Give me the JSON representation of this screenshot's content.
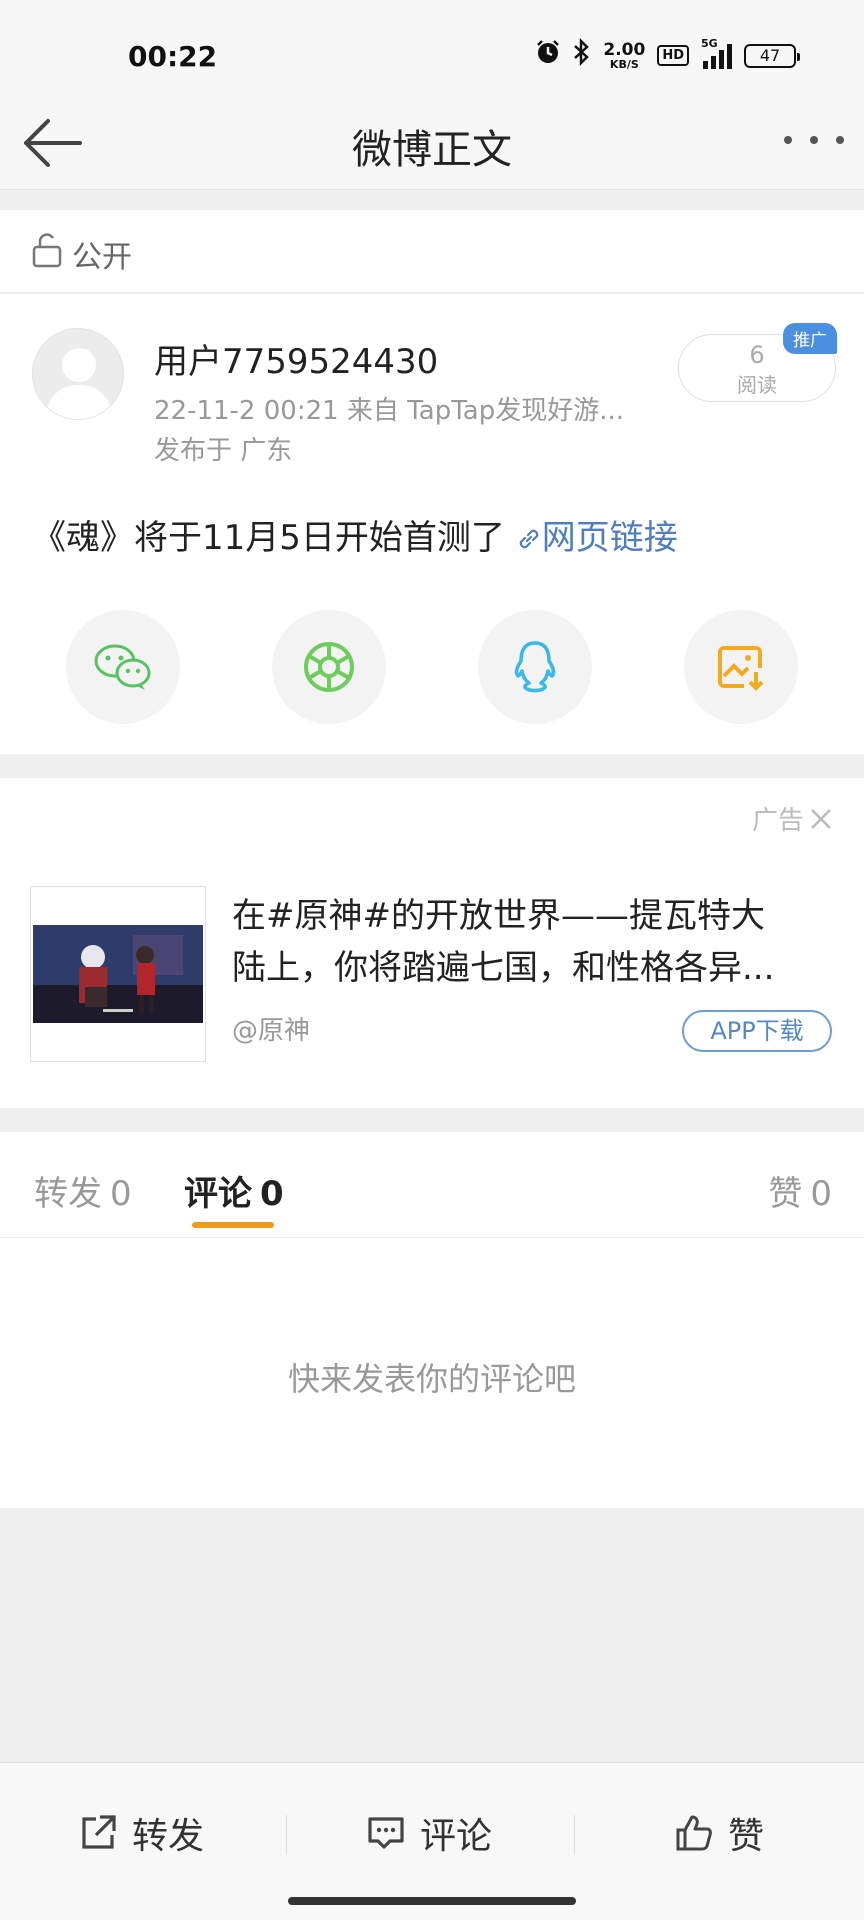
{
  "status_bar": {
    "time": "00:22",
    "net_speed": "2.00",
    "net_unit": "KB/S",
    "hd": "HD",
    "signal_label": "5G",
    "battery": "47"
  },
  "nav": {
    "title": "微博正文"
  },
  "visibility": {
    "label": "公开"
  },
  "post": {
    "username": "用户7759524430",
    "meta": "22-11-2 00:21   来自 TapTap发现好游...",
    "location": "发布于 广东",
    "read_count": "6",
    "read_label": "阅读",
    "promo_badge": "推广",
    "text": "《魂》将于11月5日开始首测了",
    "link_text": "网页链接",
    "share_buttons": [
      {
        "icon": "wechat-icon",
        "color": "#5ac264"
      },
      {
        "icon": "moments-icon",
        "color": "#6dcc5c"
      },
      {
        "icon": "qq-icon",
        "color": "#3cb8e6"
      },
      {
        "icon": "save-image-icon",
        "color": "#f4a91f"
      }
    ]
  },
  "ad": {
    "tag": "广告",
    "text_line1": "在#原神#的开放世界——提瓦特大",
    "text_line2": "陆上，你将踏遍七国，和性格各异...",
    "source": "@原神",
    "button": "APP下载"
  },
  "tabs": [
    {
      "label": "转发",
      "count": "0",
      "active": false
    },
    {
      "label": "评论",
      "count": "0",
      "active": true
    },
    {
      "label": "赞",
      "count": "0",
      "active": false
    }
  ],
  "comments": {
    "empty_text": "快来发表你的评论吧"
  },
  "bottom_bar": {
    "repost": "转发",
    "comment": "评论",
    "like": "赞"
  },
  "colors": {
    "accent": "#f09a1c",
    "link": "#4f7dbd"
  }
}
